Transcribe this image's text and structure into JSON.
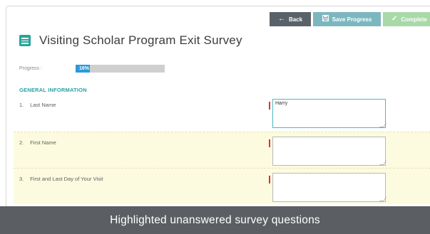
{
  "toolbar": {
    "back_label": "Back",
    "back_icon": "arrow-left-icon",
    "save_label": "Save Progress",
    "save_icon": "floppy-disk-icon",
    "complete_label": "Complete",
    "complete_icon": "checkmark-icon"
  },
  "survey": {
    "title": "Visiting Scholar Program Exit Survey",
    "title_icon": "list-icon",
    "progress_label": "Progress :",
    "progress_value": "16%",
    "progress_fraction": 0.16
  },
  "section": {
    "title": "GENERAL INFORMATION"
  },
  "questions": [
    {
      "number": "1.",
      "label": "Last Name",
      "value": "Harry",
      "required": true,
      "unanswered": false
    },
    {
      "number": "2.",
      "label": "First Name",
      "value": "",
      "required": true,
      "unanswered": true
    },
    {
      "number": "3.",
      "label": "First and Last Day of Your Visit",
      "value": "",
      "required": true,
      "unanswered": true
    }
  ],
  "caption": "Highlighted unanswered survey questions",
  "colors": {
    "accent_teal": "#26a69a",
    "progress_blue": "#2c9ad9",
    "highlight_yellow": "#fcfbe0",
    "required_red": "#e03232",
    "caption_bg": "#5b5f63"
  }
}
